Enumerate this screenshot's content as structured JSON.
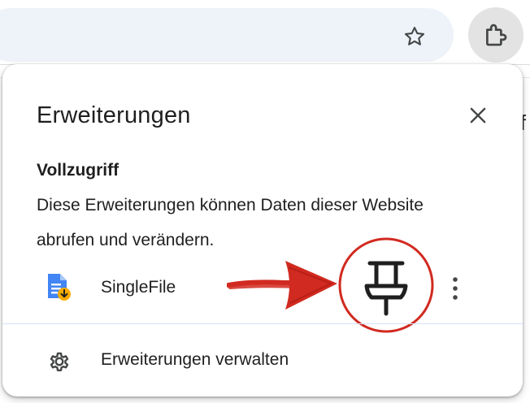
{
  "toolbar": {
    "bookmark_icon": "star-outline-icon",
    "extensions_icon": "puzzle-piece-icon",
    "background_fragment": "if"
  },
  "popup": {
    "title": "Erweiterungen",
    "close_icon": "close-icon",
    "section": {
      "heading": "Vollzugriff",
      "description": "Diese Erweiterungen können Daten dieser Website abrufen und verändern."
    },
    "extensions": [
      {
        "name": "SingleFile",
        "icon": "singlefile-document-download-icon",
        "pin_icon": "pushpin-icon",
        "more_icon": "vertical-dots-icon"
      }
    ],
    "manage": {
      "label": "Erweiterungen verwalten",
      "icon": "gear-icon"
    }
  },
  "annotation": {
    "color": "#d12a20",
    "arrow_icon": "hand-drawn-arrow-right",
    "circle_icon": "hand-drawn-circle"
  },
  "colors": {
    "omnibox_bg": "#eef2f9",
    "extension_button_bg": "#e3e3e3",
    "divider": "#d3e3fd",
    "icon": "#444746",
    "text": "#1f1f1f",
    "singlefile_blue": "#4285f4",
    "singlefile_yellow": "#f9ab00"
  }
}
